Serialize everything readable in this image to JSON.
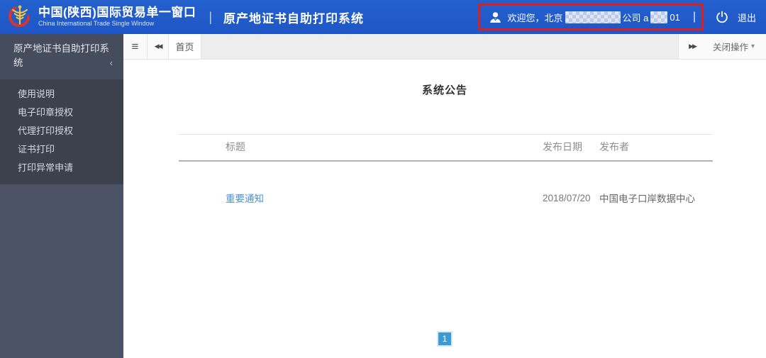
{
  "header": {
    "brand_title": "中国(陕西)国际贸易单一窗口",
    "brand_subtitle": "China International Trade Single Window",
    "app_title": "原产地证书自助打印系统",
    "welcome_prefix": "欢迎您，北京",
    "welcome_mid": "公司 a",
    "welcome_suffix": "01",
    "logout_label": "退出"
  },
  "sidebar": {
    "title": "原产地证书自助打印系统",
    "items": [
      "使用说明",
      "电子印章授权",
      "代理打印授权",
      "证书打印",
      "打印异常申请"
    ]
  },
  "tabbar": {
    "tabs": [
      {
        "label": "首页"
      }
    ],
    "close_menu_label": "关闭操作"
  },
  "main": {
    "title": "系统公告",
    "table": {
      "columns": [
        "标题",
        "发布日期",
        "发布者"
      ],
      "rows": [
        {
          "title": "重要通知",
          "date": "2018/07/20",
          "publisher": "中国电子口岸数据中心"
        }
      ]
    },
    "pagination": {
      "current_page": "1"
    }
  },
  "icons": {
    "hamburger": "≡",
    "scroll_left": "◀◀",
    "scroll_right": "▶▶",
    "caret_down": "▾",
    "collapse_chevron": "‹",
    "header_separator": "|",
    "welcome_separator": "|"
  },
  "colors": {
    "header_blue": "#2158c8",
    "annotation_red": "#e01d1d",
    "sidebar_base": "#4d5366",
    "sidebar_menu": "#3b424e",
    "link_blue": "#4a90d9",
    "pagination_blue": "#3d9ad2"
  }
}
